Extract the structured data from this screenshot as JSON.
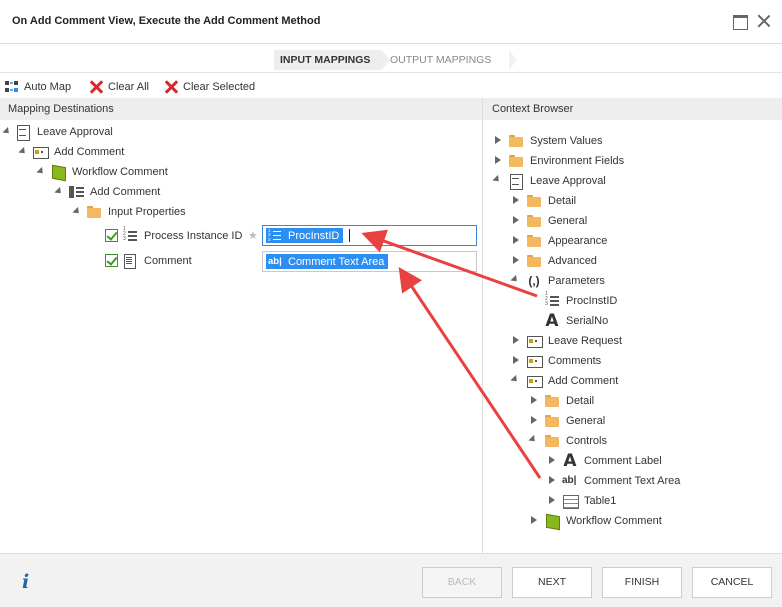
{
  "window": {
    "title": "On Add Comment View, Execute the Add Comment Method"
  },
  "steps": {
    "input": "INPUT MAPPINGS",
    "output": "OUTPUT MAPPINGS"
  },
  "toolbar": {
    "auto_map": "Auto Map",
    "clear_all": "Clear All",
    "clear_selected": "Clear Selected"
  },
  "left": {
    "header": "Mapping Destinations",
    "n0": "Leave Approval",
    "n1": "Add Comment",
    "n2": "Workflow Comment",
    "n3": "Add Comment",
    "n4": "Input Properties",
    "n5": "Process Instance ID",
    "n6": "Comment",
    "map1": "ProcInstID",
    "map2": "Comment Text Area"
  },
  "right": {
    "header": "Context Browser",
    "r0": "System Values",
    "r1": "Environment Fields",
    "r2": "Leave Approval",
    "r3": "Detail",
    "r4": "General",
    "r5": "Appearance",
    "r6": "Advanced",
    "r7": "Parameters",
    "r8": "ProcInstID",
    "r9": "SerialNo",
    "r10": "Leave Request",
    "r11": "Comments",
    "r12": "Add Comment",
    "r13": "Detail",
    "r14": "General",
    "r15": "Controls",
    "r16": "Comment Label",
    "r17": "Comment Text Area",
    "r18": "Table1",
    "r19": "Workflow Comment"
  },
  "footer": {
    "back": "BACK",
    "next": "NEXT",
    "finish": "FINISH",
    "cancel": "CANCEL"
  },
  "colors": {
    "accent": "#2d8ef2",
    "arrow": "#e8413f",
    "check": "#3a9a20"
  }
}
